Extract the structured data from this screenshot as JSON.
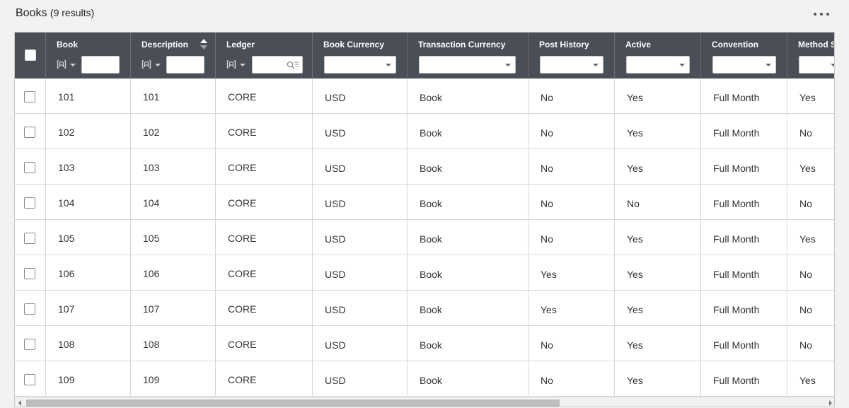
{
  "page": {
    "title": "Books",
    "result_count": "(9 results)",
    "more_icon": "more-horizontal-icon"
  },
  "columns": [
    {
      "key": "book",
      "label": "Book",
      "filter": "text",
      "filter_value": ""
    },
    {
      "key": "description",
      "label": "Description",
      "filter": "text",
      "filter_value": "",
      "sorted": "ascending"
    },
    {
      "key": "ledger",
      "label": "Ledger",
      "filter": "text-search",
      "filter_value": ""
    },
    {
      "key": "book_currency",
      "label": "Book Currency",
      "filter": "select",
      "filter_value": ""
    },
    {
      "key": "transaction_currency",
      "label": "Transaction Currency",
      "filter": "select",
      "filter_value": ""
    },
    {
      "key": "post_history",
      "label": "Post History",
      "filter": "select",
      "filter_value": ""
    },
    {
      "key": "active",
      "label": "Active",
      "filter": "select",
      "filter_value": ""
    },
    {
      "key": "convention",
      "label": "Convention",
      "filter": "select",
      "filter_value": ""
    },
    {
      "key": "method_s",
      "label": "Method S",
      "filter": "select",
      "filter_value": ""
    }
  ],
  "rows": [
    {
      "book": "101",
      "description": "101",
      "ledger": "CORE",
      "book_currency": "USD",
      "transaction_currency": "Book",
      "post_history": "No",
      "active": "Yes",
      "convention": "Full Month",
      "method_s": "Yes"
    },
    {
      "book": "102",
      "description": "102",
      "ledger": "CORE",
      "book_currency": "USD",
      "transaction_currency": "Book",
      "post_history": "No",
      "active": "Yes",
      "convention": "Full Month",
      "method_s": "No"
    },
    {
      "book": "103",
      "description": "103",
      "ledger": "CORE",
      "book_currency": "USD",
      "transaction_currency": "Book",
      "post_history": "No",
      "active": "Yes",
      "convention": "Full Month",
      "method_s": "Yes"
    },
    {
      "book": "104",
      "description": "104",
      "ledger": "CORE",
      "book_currency": "USD",
      "transaction_currency": "Book",
      "post_history": "No",
      "active": "No",
      "convention": "Full Month",
      "method_s": "No"
    },
    {
      "book": "105",
      "description": "105",
      "ledger": "CORE",
      "book_currency": "USD",
      "transaction_currency": "Book",
      "post_history": "No",
      "active": "Yes",
      "convention": "Full Month",
      "method_s": "Yes"
    },
    {
      "book": "106",
      "description": "106",
      "ledger": "CORE",
      "book_currency": "USD",
      "transaction_currency": "Book",
      "post_history": "Yes",
      "active": "Yes",
      "convention": "Full Month",
      "method_s": "No"
    },
    {
      "book": "107",
      "description": "107",
      "ledger": "CORE",
      "book_currency": "USD",
      "transaction_currency": "Book",
      "post_history": "Yes",
      "active": "Yes",
      "convention": "Full Month",
      "method_s": "No"
    },
    {
      "book": "108",
      "description": "108",
      "ledger": "CORE",
      "book_currency": "USD",
      "transaction_currency": "Book",
      "post_history": "No",
      "active": "Yes",
      "convention": "Full Month",
      "method_s": "No"
    },
    {
      "book": "109",
      "description": "109",
      "ledger": "CORE",
      "book_currency": "USD",
      "transaction_currency": "Book",
      "post_history": "No",
      "active": "Yes",
      "convention": "Full Month",
      "method_s": "Yes"
    }
  ],
  "colors": {
    "header_bg": "#4a4e57",
    "header_text": "#ffffff",
    "grid_border": "#d6d6d6",
    "page_bg": "#f2f2f2"
  }
}
